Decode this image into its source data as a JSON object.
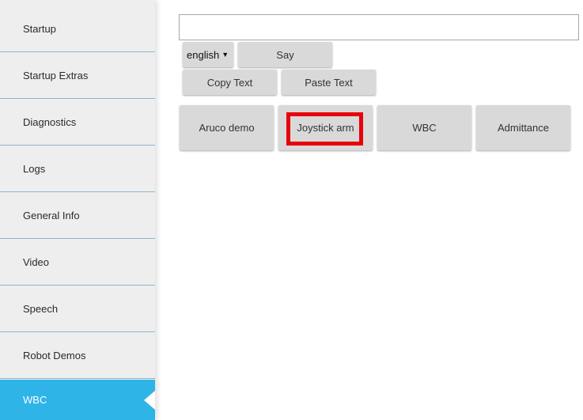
{
  "sidebar": {
    "items": [
      {
        "label": "Startup"
      },
      {
        "label": "Startup Extras"
      },
      {
        "label": "Diagnostics"
      },
      {
        "label": "Logs"
      },
      {
        "label": "General Info"
      },
      {
        "label": "Video"
      },
      {
        "label": "Speech"
      },
      {
        "label": "Robot Demos"
      },
      {
        "label": "WBC"
      }
    ],
    "active_color": "#2fb4e8"
  },
  "speech": {
    "input_value": "",
    "language": "english",
    "say_label": "Say",
    "copy_label": "Copy Text",
    "paste_label": "Paste Text"
  },
  "demos": {
    "buttons": [
      {
        "label": "Aruco demo"
      },
      {
        "label": "Joystick arm"
      },
      {
        "label": "WBC"
      },
      {
        "label": "Admittance"
      }
    ],
    "highlight_color": "#e8000b"
  }
}
